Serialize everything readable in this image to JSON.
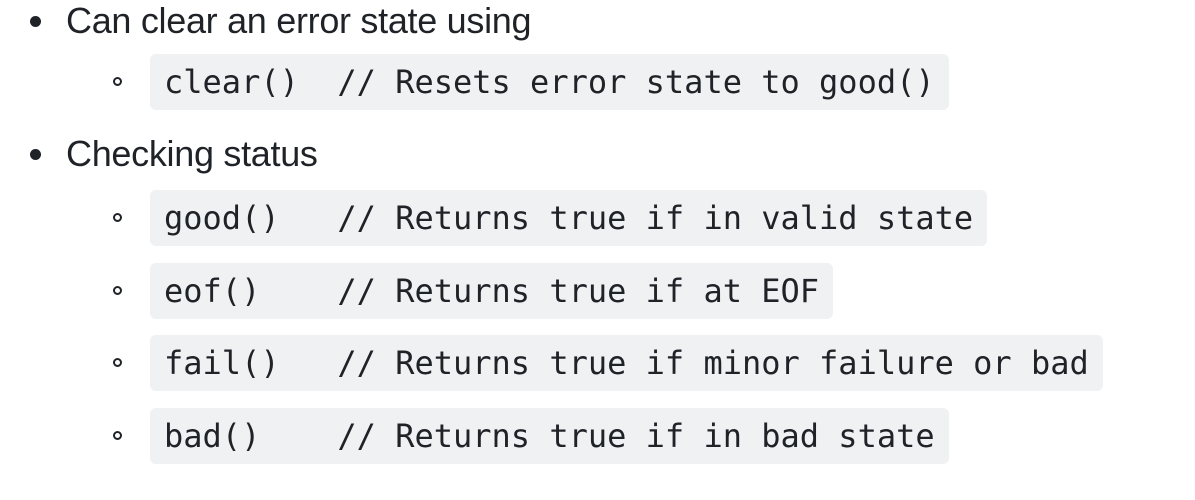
{
  "items": [
    {
      "text": "Can clear an error state using",
      "sub": [
        {
          "code": "clear()  // Resets error state to good()"
        }
      ]
    },
    {
      "text": "Checking status",
      "sub": [
        {
          "code": "good()   // Returns true if in valid state"
        },
        {
          "code": "eof()    // Returns true if at EOF"
        },
        {
          "code": "fail()   // Returns true if minor failure or bad"
        },
        {
          "code": "bad()    // Returns true if in bad state"
        }
      ]
    }
  ]
}
